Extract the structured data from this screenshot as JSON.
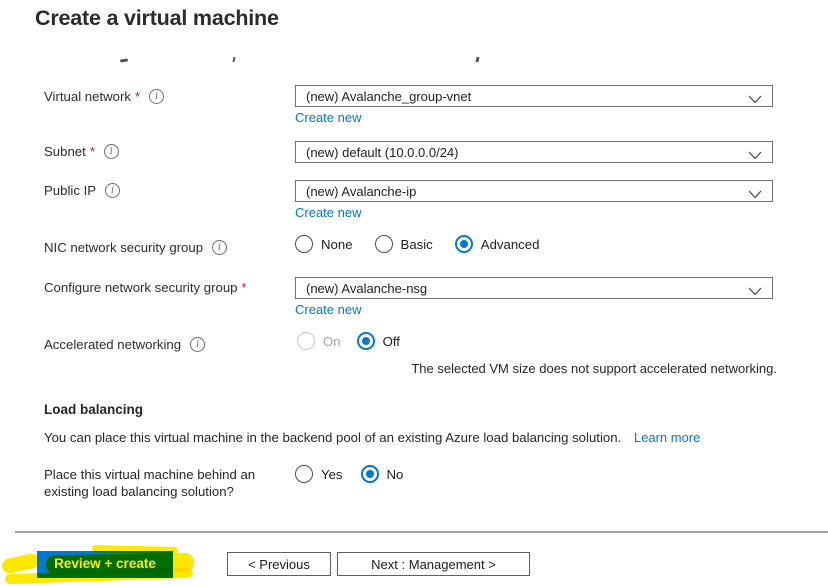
{
  "page": {
    "title": "Create a virtual machine"
  },
  "form": {
    "required_marker": "*",
    "info_glyph": "i",
    "virtual_network": {
      "label": "Virtual network",
      "value": "(new) Avalanche_group-vnet",
      "create_new": "Create new"
    },
    "subnet": {
      "label": "Subnet",
      "value": "(new) default (10.0.0.0/24)"
    },
    "public_ip": {
      "label": "Public IP",
      "value": "(new) Avalanche-ip",
      "create_new": "Create new"
    },
    "nic_nsg": {
      "label": "NIC network security group",
      "options": {
        "none": "None",
        "basic": "Basic",
        "advanced": "Advanced"
      },
      "selected": "Advanced"
    },
    "configure_nsg": {
      "label": "Configure network security group",
      "value": "(new) Avalanche-nsg",
      "create_new": "Create new"
    },
    "accelerated_networking": {
      "label": "Accelerated networking",
      "options": {
        "on": "On",
        "off": "Off"
      },
      "selected": "Off",
      "note": "The selected VM size does not support accelerated networking."
    }
  },
  "load_balancing": {
    "heading": "Load balancing",
    "description": "You can place this virtual machine in the backend pool of an existing Azure load balancing solution.",
    "learn_more": "Learn more",
    "question": "Place this virtual machine behind an existing load balancing solution?",
    "options": {
      "yes": "Yes",
      "no": "No"
    },
    "selected": "No"
  },
  "footer": {
    "review_create": "Review + create",
    "previous": "< Previous",
    "next": "Next : Management >"
  },
  "colors": {
    "accent": "#0078d4",
    "link": "#0078d4",
    "required": "#a4262c",
    "highlighter": "#ffe800",
    "highlighted_button_text": "#ffec00"
  }
}
